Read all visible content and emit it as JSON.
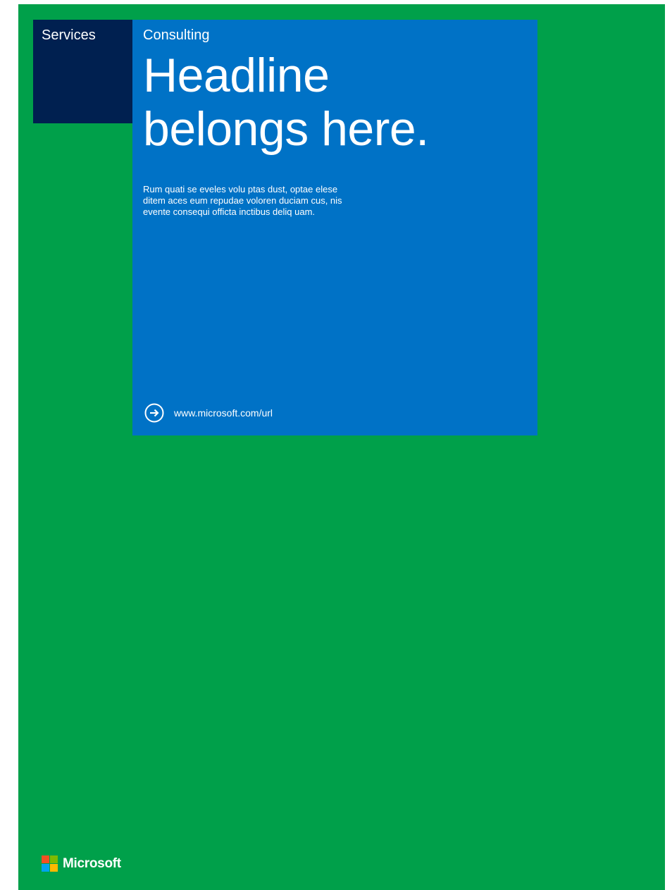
{
  "tiles": {
    "service_label": "Services",
    "category_label": "Consulting"
  },
  "headline": {
    "line1": "Headline",
    "line2": "belongs here."
  },
  "body": "Rum quati se eveles volu ptas dust, optae elese ditem aces eum repudae voloren duciam cus, nis evente consequi officta inctibus deliq uam.",
  "link": {
    "icon": "arrow-circle-right-icon",
    "text": "www.microsoft.com/url"
  },
  "brand": {
    "name": "Microsoft",
    "logo_colors": [
      "#f25022",
      "#7fba00",
      "#00a4ef",
      "#ffb900"
    ]
  },
  "colors": {
    "page_background": "#00a04a",
    "service_tile": "#002050",
    "main_tile": "#0072c6"
  }
}
